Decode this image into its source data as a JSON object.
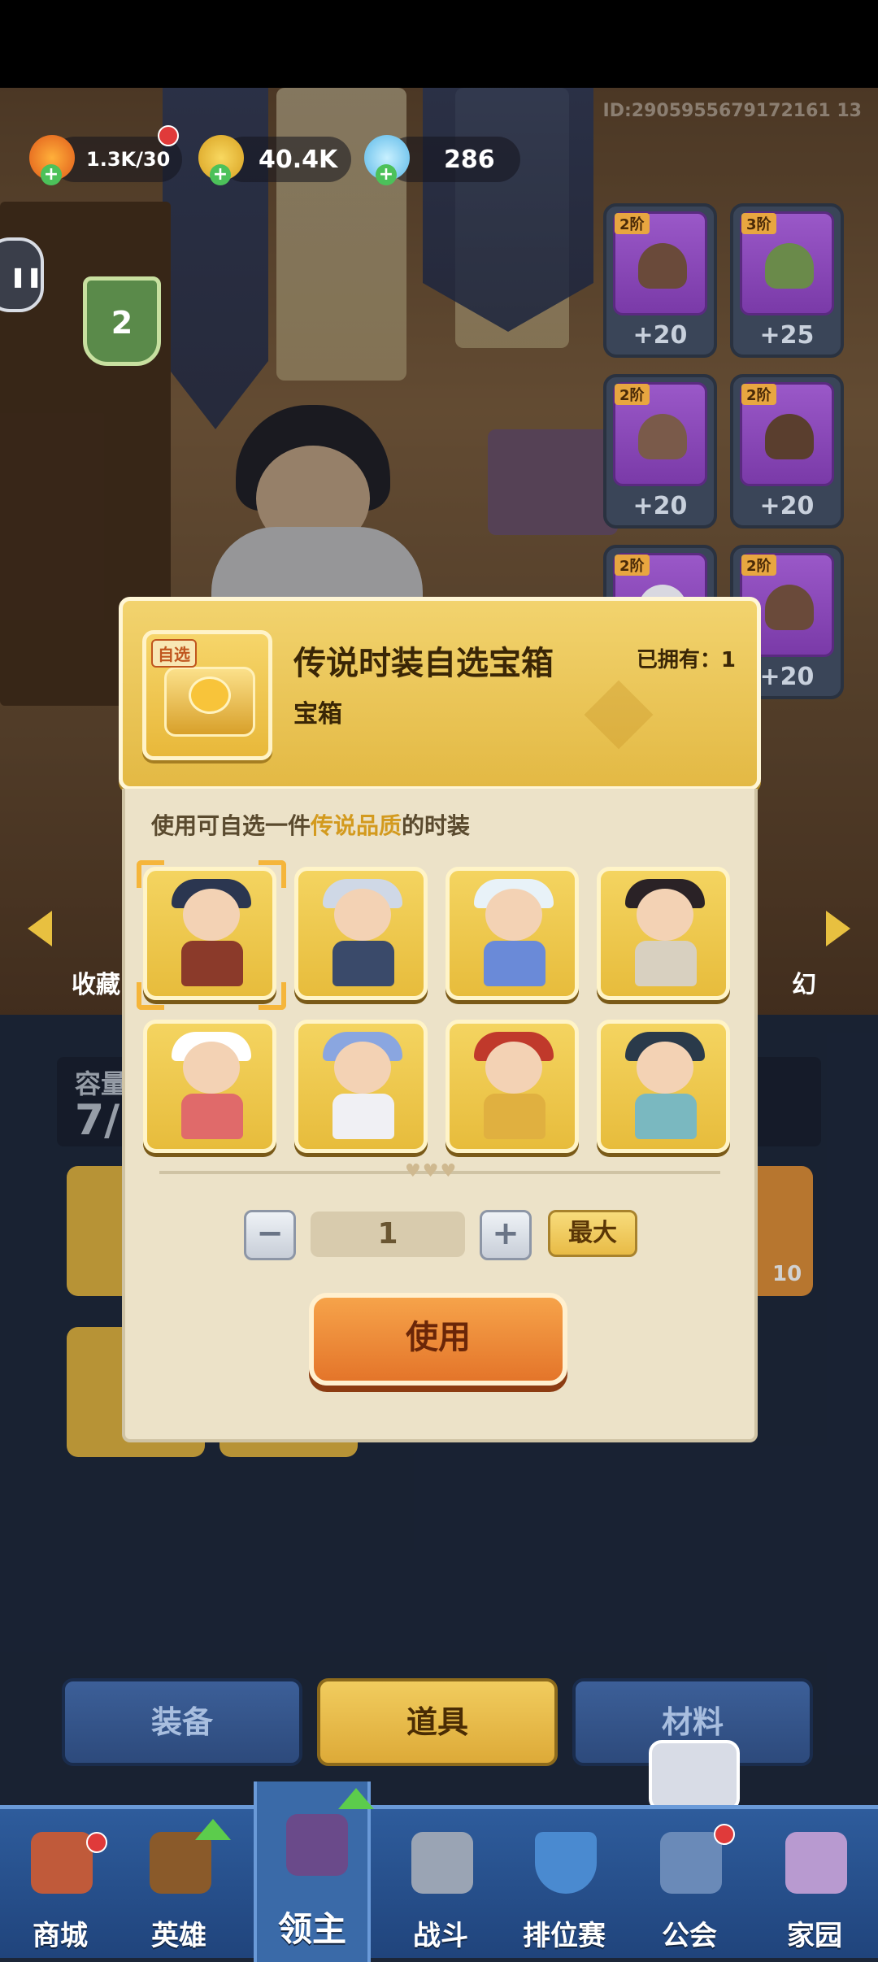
{
  "resources": {
    "stamina": "1.3K/30",
    "gold": "40.4K",
    "gems": "286"
  },
  "player_id": "ID:2905955679172161 13",
  "rank_badge": "2",
  "equipment_slots": [
    {
      "tier": "2阶",
      "value": "+20",
      "icon": "fur-hat-icon"
    },
    {
      "tier": "3阶",
      "value": "+25",
      "icon": "fur-coat-icon"
    },
    {
      "tier": "2阶",
      "value": "+20",
      "icon": "fur-boot-icon"
    },
    {
      "tier": "2阶",
      "value": "+20",
      "icon": "fur-glove-icon"
    },
    {
      "tier": "2阶",
      "value": "",
      "icon": "fur-collar-icon"
    },
    {
      "tier": "2阶",
      "value": "+20",
      "icon": "fur-pants-icon"
    }
  ],
  "side_labels": {
    "left": "收藏",
    "right": "幻"
  },
  "inventory_capacity": "7/",
  "inventory_badge": "10",
  "modal": {
    "tag": "自选",
    "title": "传说时装自选宝箱",
    "type": "宝箱",
    "owned": "已拥有：1",
    "desc_prefix": "使用可自选一件",
    "desc_highlight": "传说品质",
    "desc_suffix": "的时装",
    "outfits": [
      {
        "name": "pirate-outfit-icon",
        "hat": "#2b3650",
        "body": "#8b3a2a"
      },
      {
        "name": "wolf-outfit-icon",
        "hat": "#cfd8e6",
        "body": "#3a4a6a"
      },
      {
        "name": "goggles-outfit-icon",
        "hat": "#e8f2f8",
        "body": "#6a8ad8"
      },
      {
        "name": "tophat-outfit-icon",
        "hat": "#2a2226",
        "body": "#d8d0c0"
      },
      {
        "name": "sailor-outfit-icon",
        "hat": "#ffffff",
        "body": "#e06a6a"
      },
      {
        "name": "monocle-outfit-icon",
        "hat": "#8aa6e0",
        "body": "#f0f0f4"
      },
      {
        "name": "royal-outfit-icon",
        "hat": "#c0392b",
        "body": "#e0b040"
      },
      {
        "name": "plague-outfit-icon",
        "hat": "#2a3a4a",
        "body": "#7ab8c0"
      }
    ],
    "quantity": "1",
    "minus": "−",
    "plus": "+",
    "max_label": "最大",
    "use_label": "使用"
  },
  "categories": [
    {
      "label": "装备",
      "active": false
    },
    {
      "label": "道具",
      "active": true
    },
    {
      "label": "材料",
      "active": false
    }
  ],
  "nav": [
    {
      "label": "商城",
      "icon": "shop-icon",
      "red_dot": true,
      "up": false
    },
    {
      "label": "英雄",
      "icon": "hero-card-icon",
      "red_dot": false,
      "up": true
    },
    {
      "label": "领主",
      "icon": "lord-banner-icon",
      "red_dot": false,
      "up": true,
      "active": true
    },
    {
      "label": "战斗",
      "icon": "battle-swords-icon",
      "red_dot": false,
      "up": false
    },
    {
      "label": "排位赛",
      "icon": "ranked-shield-icon",
      "red_dot": false,
      "up": false
    },
    {
      "label": "公会",
      "icon": "guild-castle-icon",
      "red_dot": true,
      "up": false
    },
    {
      "label": "家园",
      "icon": "home-castle-icon",
      "red_dot": false,
      "up": false
    }
  ],
  "colors": {
    "accent_gold": "#e7bc3c",
    "highlight_text": "#d39a1e",
    "use_button": "#e4752a",
    "nav_blue": "#2e5c9c"
  }
}
